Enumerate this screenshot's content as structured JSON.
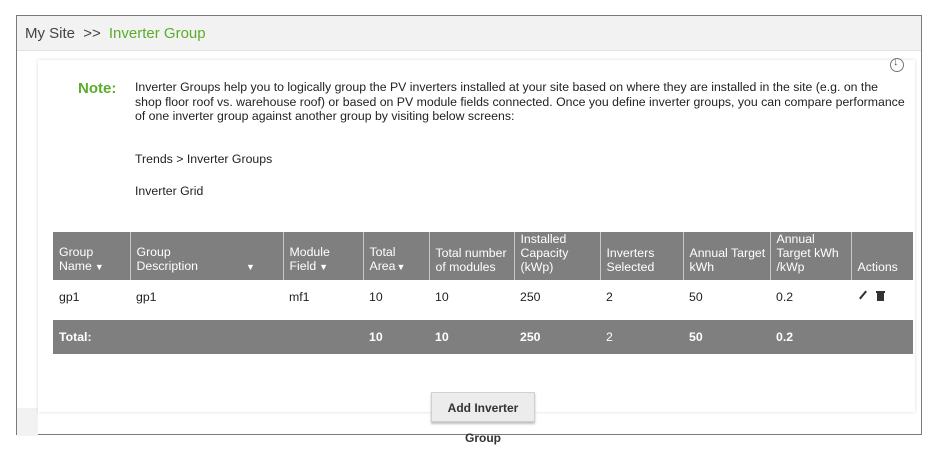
{
  "breadcrumb": {
    "root": "My Site",
    "separator": ">>",
    "current": "Inverter Group"
  },
  "colors": {
    "accent": "#5cac2b",
    "header_bg": "#7f7f7f"
  },
  "note": {
    "label": "Note:",
    "text": "Inverter Groups help you to logically group the PV inverters installed at your site based on where they are installed in the site (e.g. on the shop floor roof vs. warehouse roof) or based on PV module fields connected. Once you define inverter groups, you can compare performance of one inverter group against another group by visiting below screens:",
    "links": [
      "Trends > Inverter Groups",
      "Inverter Grid"
    ]
  },
  "table": {
    "columns": [
      "Group Name",
      "Group Description",
      "Module Field",
      "Total Area",
      "Total number of modules",
      "Installed Capacity (kWp)",
      "Inverters Selected",
      "Annual Target kWh",
      "Annual Target kWh /kWp",
      "Actions"
    ],
    "rows": [
      {
        "group_name": "gp1",
        "description": "gp1",
        "module_field": "mf1",
        "total_area": "10",
        "modules": "10",
        "capacity": "250",
        "inverters": "2",
        "annual_kwh": "50",
        "annual_kwh_kwp": "0.2"
      }
    ],
    "total": {
      "label": "Total:",
      "total_area": "10",
      "modules": "10",
      "capacity": "250",
      "inverters": "2",
      "annual_kwh": "50",
      "annual_kwh_kwp": "0.2"
    }
  },
  "add_button": "Add Inverter Group",
  "icons": {
    "download": "download-icon",
    "edit": "pencil-icon",
    "delete": "trash-icon",
    "sort": "sort-arrow-icon"
  }
}
